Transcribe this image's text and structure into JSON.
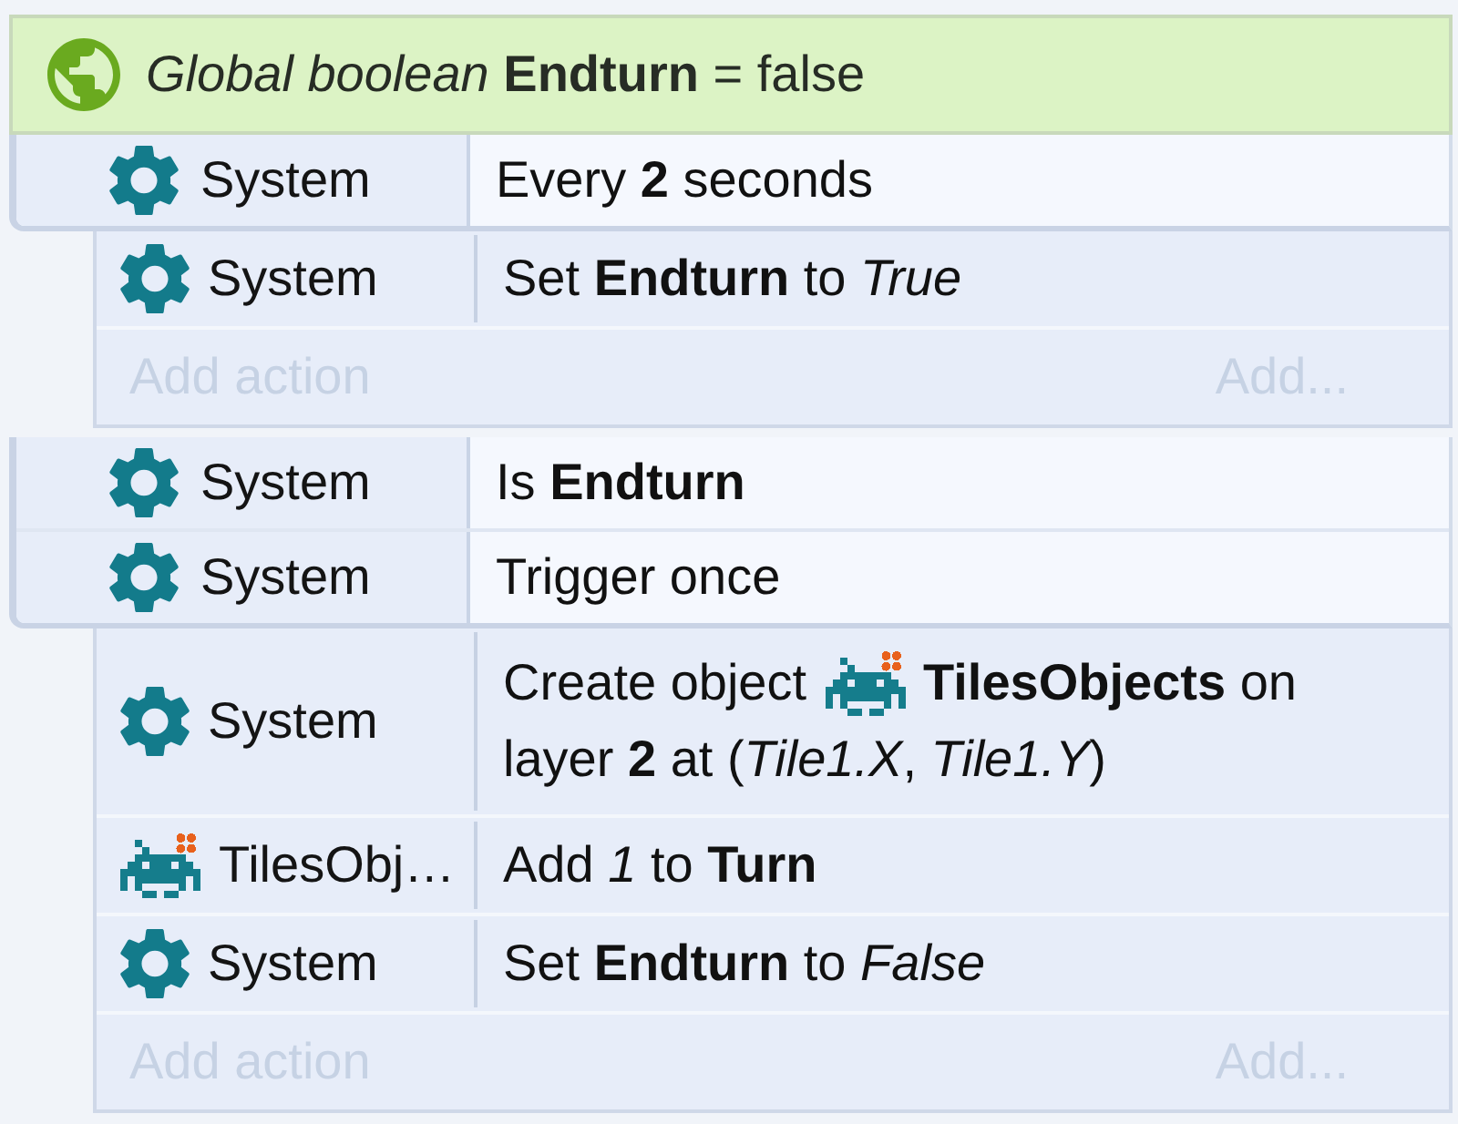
{
  "global_variable": {
    "text": "*Global boolean* **Endturn** = false"
  },
  "events": [
    {
      "conditions": [
        {
          "kind": "system",
          "object": "System",
          "text": "Every **2** seconds"
        }
      ],
      "actions": [
        {
          "kind": "system",
          "object": "System",
          "text": "Set **Endturn** to *True*"
        }
      ],
      "add_action": "Add action",
      "add": "Add..."
    },
    {
      "conditions": [
        {
          "kind": "system",
          "object": "System",
          "text": "Is **Endturn**"
        },
        {
          "kind": "system",
          "object": "System",
          "text": "Trigger once"
        }
      ],
      "actions": [
        {
          "kind": "system",
          "object": "System",
          "lines": [
            [
              {
                "kind": "text",
                "text": "Create object"
              },
              {
                "kind": "sprite"
              },
              {
                "kind": "text",
                "text": "**TilesObjects** on"
              }
            ],
            [
              {
                "kind": "text",
                "text": "layer **2** at (*Tile1.X*, *Tile1.Y*)"
              }
            ]
          ]
        },
        {
          "kind": "sprite",
          "object": "TilesObj…",
          "text": "Add *1* to **Turn**"
        },
        {
          "kind": "system",
          "object": "System",
          "text": "Set **Endturn** to *False*"
        }
      ],
      "add_action": "Add action",
      "add": "Add..."
    }
  ]
}
